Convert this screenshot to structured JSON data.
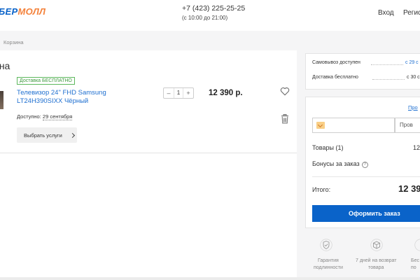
{
  "header": {
    "logo_main": "БЕР",
    "logo_accent": "МОЛЛ",
    "phone": "+7 (423) 225-25-25",
    "hours": "(с 10:00 до 21:00)",
    "login": "Вход",
    "register": "Регис"
  },
  "breadcrumb": "Корзина",
  "page_title": "ина",
  "cart": {
    "item": {
      "badge": "Доставка БЕСПЛАТНО",
      "name": "Телевизор 24\" FHD Samsung LT24H390SIXX Чёрный",
      "qty_minus": "–",
      "qty": "1",
      "qty_plus": "+",
      "price": "12 390 р.",
      "delivery_label": "Доступно: ",
      "delivery_date": "29 сентября",
      "services_button": "Выбрать услуги"
    }
  },
  "shipping": {
    "pickup_label": "Самовывоз доступен",
    "pickup_value": "с 29 с",
    "delivery_label": "Доставка бесплатно",
    "delivery_value": "с 30 с"
  },
  "promo": {
    "link": "Про",
    "check_button": "Пров"
  },
  "summary": {
    "goods_label": "Товары (1)",
    "goods_value": "12",
    "bonus_label": "Бонусы за заказ",
    "bonus_value": "",
    "bonus_hint": "?",
    "total_label": "Итого:",
    "total_value": "12 39",
    "order_button": "Оформить заказ"
  },
  "features": [
    {
      "line1": "Гарантия",
      "line2": "подлинности"
    },
    {
      "line1": "7 дней на возврат",
      "line2": "товара"
    },
    {
      "line1": "Бес",
      "line2": "по"
    }
  ],
  "colors": {
    "brand_blue": "#0a63c9",
    "brand_orange": "#f4823b",
    "link_blue": "#1e6fd0",
    "badge_green": "#3f9a3f"
  }
}
